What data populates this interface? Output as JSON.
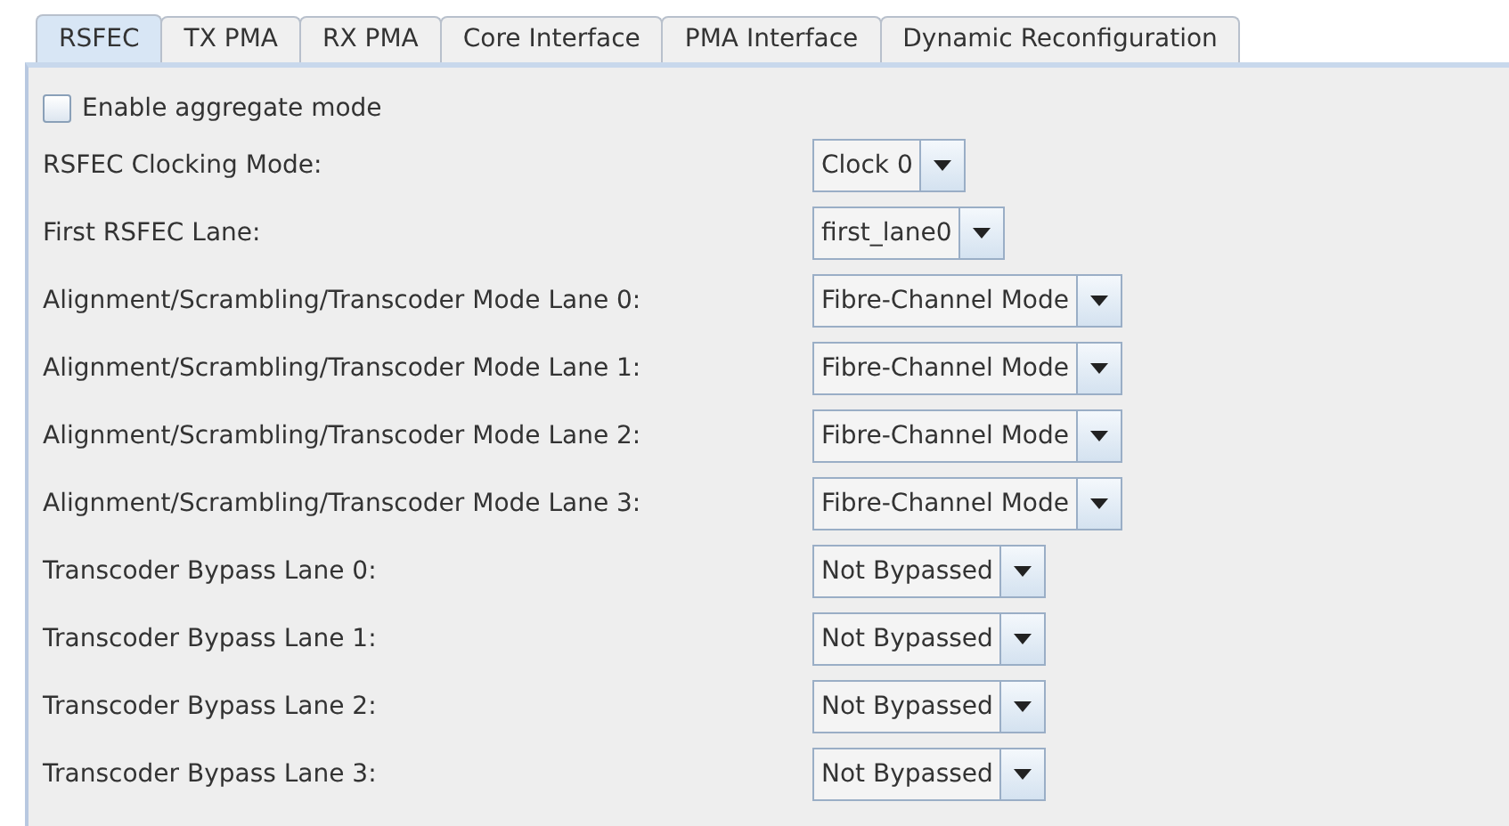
{
  "tabs": [
    {
      "label": "RSFEC",
      "selected": true
    },
    {
      "label": "TX PMA",
      "selected": false
    },
    {
      "label": "RX PMA",
      "selected": false
    },
    {
      "label": "Core Interface",
      "selected": false
    },
    {
      "label": "PMA Interface",
      "selected": false
    },
    {
      "label": "Dynamic Reconfiguration",
      "selected": false
    }
  ],
  "aggregate_mode": {
    "label": "Enable aggregate mode",
    "checked": false
  },
  "settings": [
    {
      "label": "RSFEC Clocking Mode:",
      "value": "Clock 0"
    },
    {
      "label": "First RSFEC Lane:",
      "value": "first_lane0"
    },
    {
      "label": "Alignment/Scrambling/Transcoder Mode Lane 0:",
      "value": "Fibre-Channel Mode"
    },
    {
      "label": "Alignment/Scrambling/Transcoder Mode Lane 1:",
      "value": "Fibre-Channel Mode"
    },
    {
      "label": "Alignment/Scrambling/Transcoder Mode Lane 2:",
      "value": "Fibre-Channel Mode"
    },
    {
      "label": "Alignment/Scrambling/Transcoder Mode Lane 3:",
      "value": "Fibre-Channel Mode"
    },
    {
      "label": "Transcoder Bypass Lane 0:",
      "value": "Not Bypassed"
    },
    {
      "label": "Transcoder Bypass Lane 1:",
      "value": "Not Bypassed"
    },
    {
      "label": "Transcoder Bypass Lane 2:",
      "value": "Not Bypassed"
    },
    {
      "label": "Transcoder Bypass Lane 3:",
      "value": "Not Bypassed"
    }
  ]
}
